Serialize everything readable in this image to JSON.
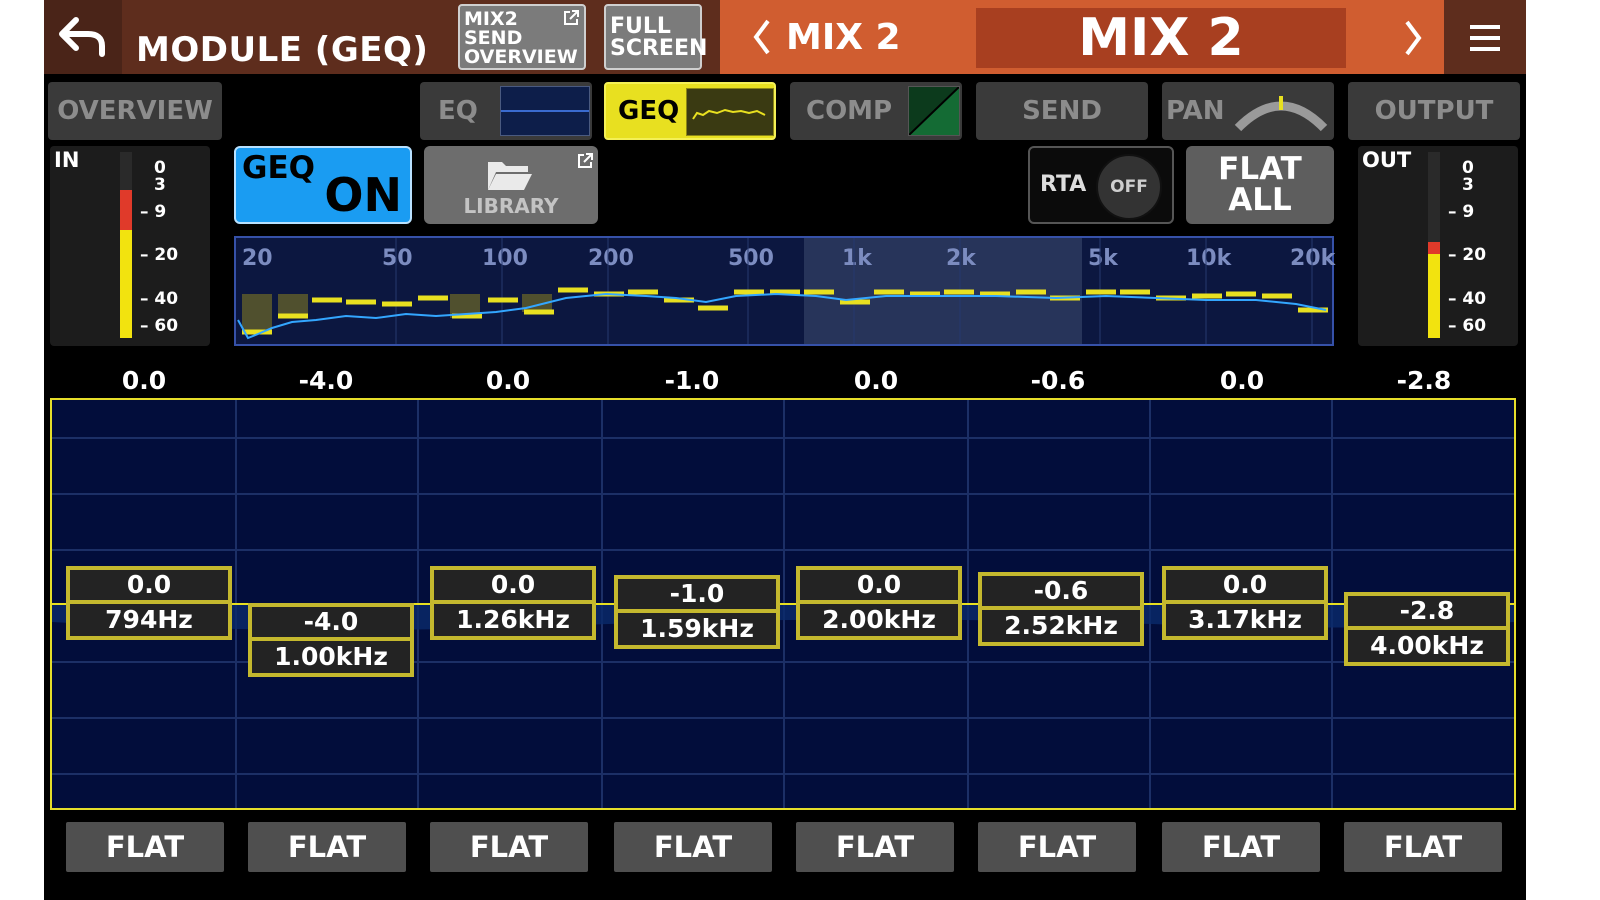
{
  "header": {
    "title": "MODULE (GEQ)",
    "send_overview": [
      "MIX2",
      "SEND",
      "OVERVIEW"
    ],
    "full_screen": [
      "FULL",
      "SCREEN"
    ],
    "prev_mix": "MIX 2",
    "current_mix": "MIX 2"
  },
  "tabs": {
    "overview": "OVERVIEW",
    "eq": "EQ",
    "geq": "GEQ",
    "comp": "COMP",
    "send": "SEND",
    "pan": "PAN",
    "output": "OUTPUT"
  },
  "meters": {
    "in_label": "IN",
    "out_label": "OUT",
    "scale": [
      "0",
      "3",
      "9",
      "20",
      "40",
      "60"
    ],
    "in_level": 0.68,
    "in_peak_level": 0.58,
    "out_level": 0.48,
    "out_peak_level": 0.45
  },
  "controls": {
    "geq_label": "GEQ",
    "geq_state": "ON",
    "library_label": "LIBRARY",
    "rta_label": "RTA",
    "rta_state": "OFF",
    "flat_all": [
      "FLAT",
      "ALL"
    ]
  },
  "overview_graph": {
    "freq_labels": [
      "20",
      "50",
      "100",
      "200",
      "500",
      "1k",
      "2k",
      "5k",
      "10k",
      "20k"
    ]
  },
  "bands": [
    {
      "value": "0.0",
      "freq": "794Hz",
      "flat": "FLAT",
      "gain": 0.0
    },
    {
      "value": "-4.0",
      "freq": "1.00kHz",
      "flat": "FLAT",
      "gain": -4.0
    },
    {
      "value": "0.0",
      "freq": "1.26kHz",
      "flat": "FLAT",
      "gain": 0.0
    },
    {
      "value": "-1.0",
      "freq": "1.59kHz",
      "flat": "FLAT",
      "gain": -1.0
    },
    {
      "value": "0.0",
      "freq": "2.00kHz",
      "flat": "FLAT",
      "gain": 0.0
    },
    {
      "value": "-0.6",
      "freq": "2.52kHz",
      "flat": "FLAT",
      "gain": -0.6
    },
    {
      "value": "0.0",
      "freq": "3.17kHz",
      "flat": "FLAT",
      "gain": 0.0
    },
    {
      "value": "-2.8",
      "freq": "4.00kHz",
      "flat": "FLAT",
      "gain": -2.8
    }
  ],
  "colors": {
    "accent_yellow": "#e8e020",
    "geq_on_blue": "#1a9cf2",
    "header_orange": "#d05d30",
    "graph_bg": "#020d3b"
  }
}
